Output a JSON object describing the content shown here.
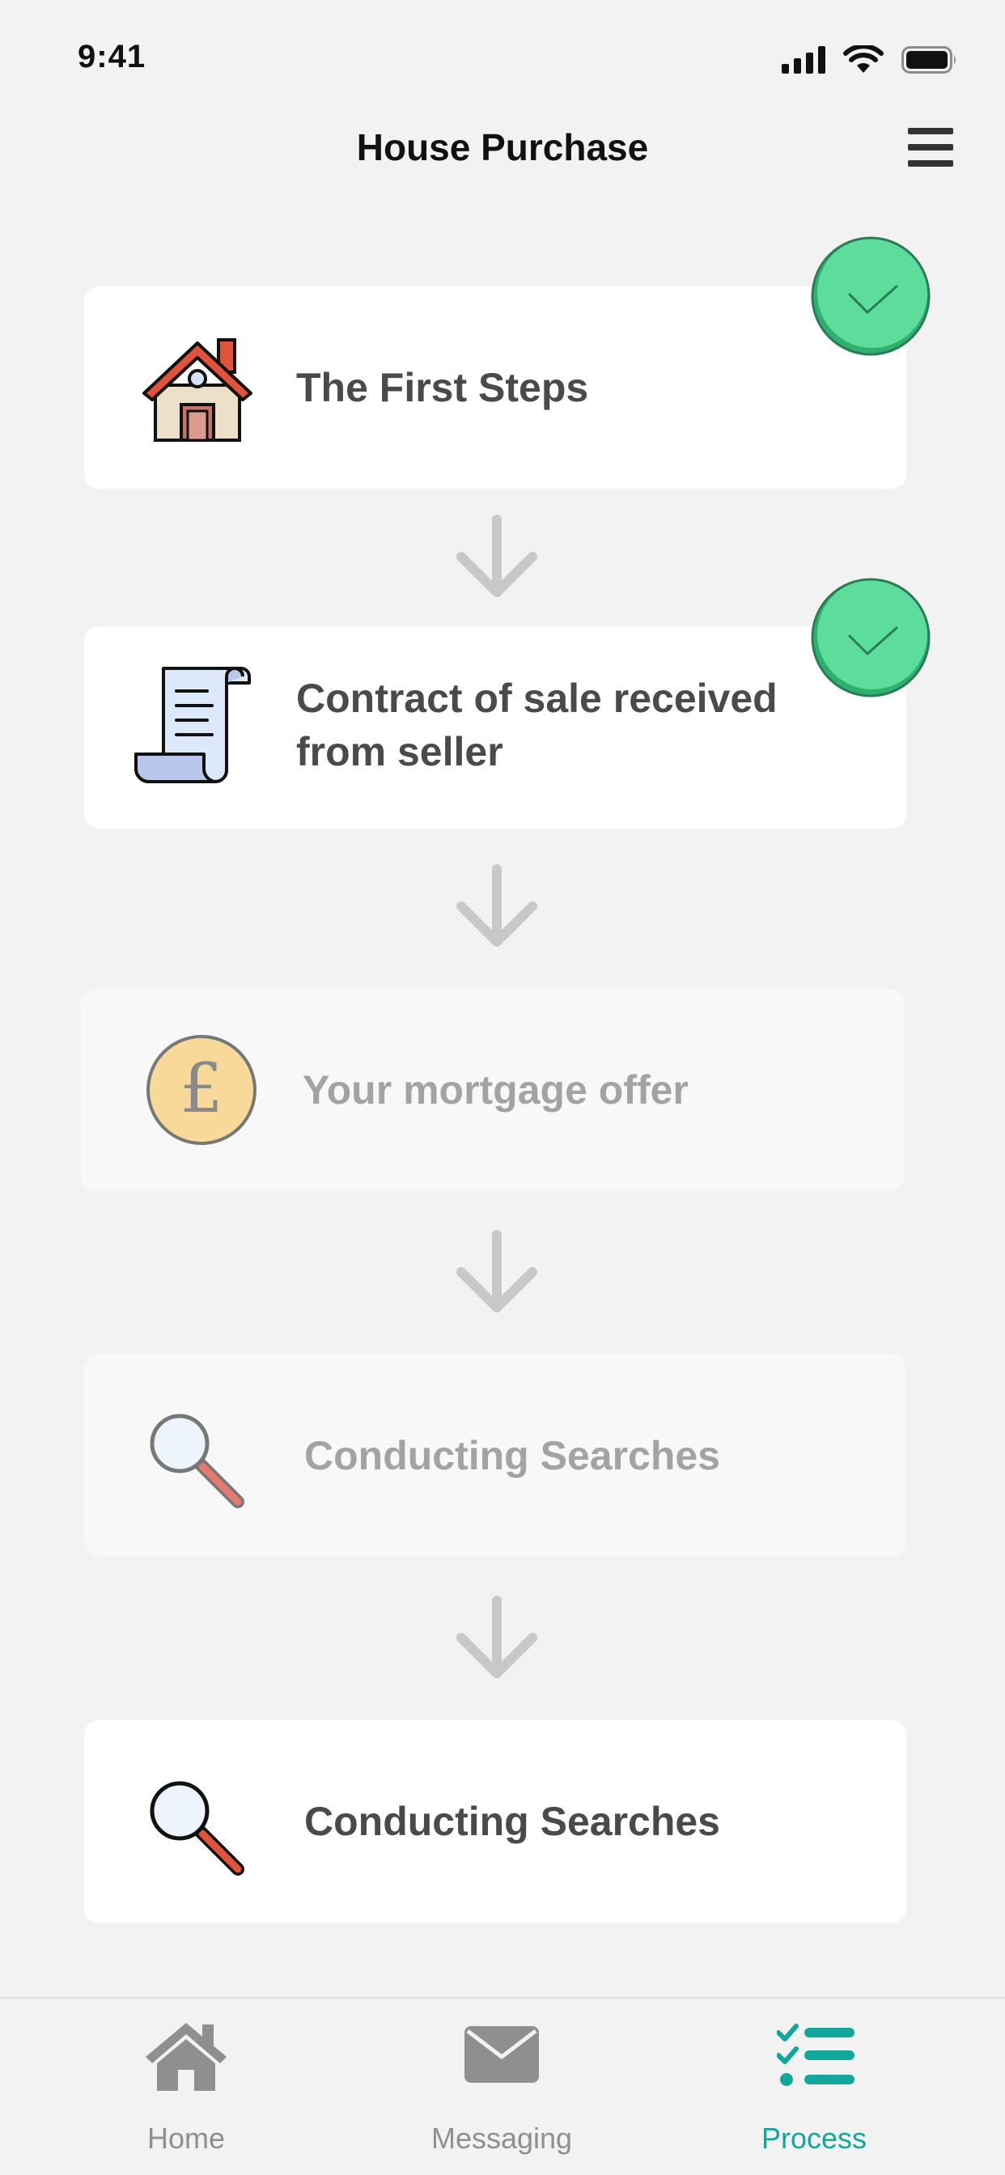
{
  "status_bar": {
    "time": "9:41"
  },
  "header": {
    "title": "House Purchase"
  },
  "steps": [
    {
      "label": "The First Steps",
      "state": "completed",
      "icon": "house-icon"
    },
    {
      "label": "Contract of sale received from seller",
      "state": "completed",
      "icon": "scroll-icon"
    },
    {
      "label": "Your mortgage offer",
      "state": "pending",
      "icon": "pound-coin-icon"
    },
    {
      "label": "Conducting Searches",
      "state": "pending",
      "icon": "magnifier-icon"
    },
    {
      "label": "Conducting Searches",
      "state": "active",
      "icon": "magnifier-icon"
    }
  ],
  "tabs": [
    {
      "label": "Home",
      "icon": "home-icon",
      "active": false
    },
    {
      "label": "Messaging",
      "icon": "envelope-icon",
      "active": false
    },
    {
      "label": "Process",
      "icon": "checklist-icon",
      "active": true
    }
  ],
  "colors": {
    "accent": "#12a79b",
    "check_green": "#5cdd9c",
    "background": "#f2f2f2",
    "card": "#ffffff"
  }
}
